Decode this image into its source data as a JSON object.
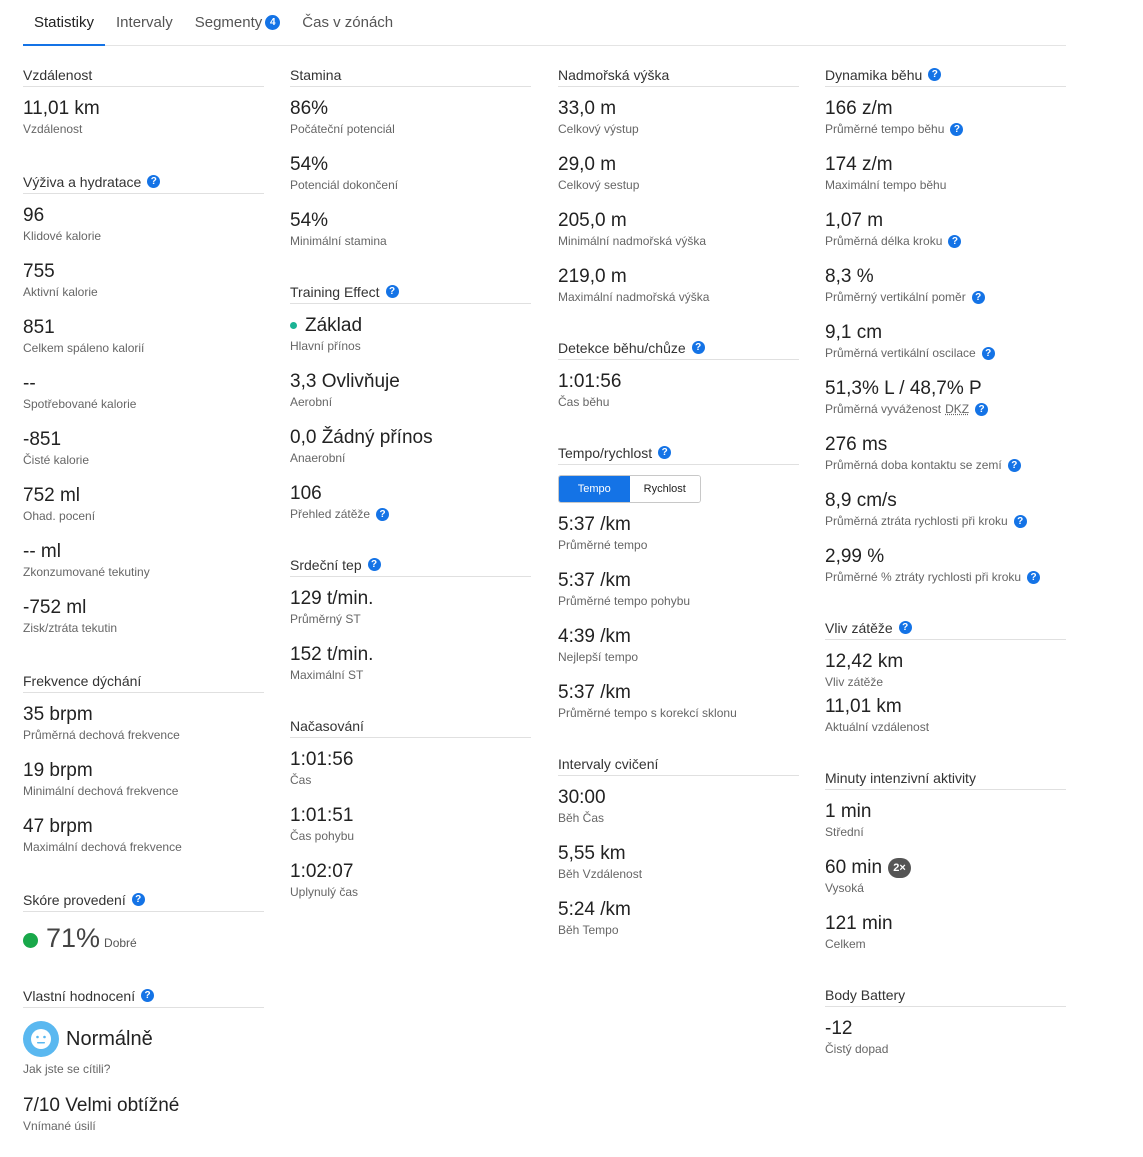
{
  "tabs": [
    {
      "label": "Statistiky"
    },
    {
      "label": "Intervaly"
    },
    {
      "label": "Segmenty",
      "badge": "4"
    },
    {
      "label": "Čas v zónách"
    }
  ],
  "distance": {
    "title": "Vzdálenost",
    "value": "11,01 km",
    "label": "Vzdálenost"
  },
  "nutrition": {
    "title": "Výživa a hydratace",
    "stats": [
      {
        "value": "96",
        "label": "Klidové kalorie"
      },
      {
        "value": "755",
        "label": "Aktivní kalorie"
      },
      {
        "value": "851",
        "label": "Celkem spáleno kalorií"
      },
      {
        "value": "--",
        "label": "Spotřebované kalorie"
      },
      {
        "value": "-851",
        "label": "Čisté kalorie"
      },
      {
        "value": "752 ml",
        "label": "Ohad. pocení"
      },
      {
        "value": "-- ml",
        "label": "Zkonzumované tekutiny"
      },
      {
        "value": "-752 ml",
        "label": "Zisk/ztráta tekutin"
      }
    ]
  },
  "breathing": {
    "title": "Frekvence dýchání",
    "stats": [
      {
        "value": "35 brpm",
        "label": "Průměrná dechová frekvence"
      },
      {
        "value": "19 brpm",
        "label": "Minimální dechová frekvence"
      },
      {
        "value": "47 brpm",
        "label": "Maximální dechová frekvence"
      }
    ]
  },
  "performance": {
    "title": "Skóre provedení",
    "value": "71%",
    "quality": "Dobré"
  },
  "self_eval": {
    "title": "Vlastní hodnocení",
    "feel": "Normálně",
    "feel_label": "Jak jste se cítili?",
    "effort": "7/10 Velmi obtížné",
    "effort_label": "Vnímané úsilí"
  },
  "stamina": {
    "title": "Stamina",
    "stats": [
      {
        "value": "86%",
        "label": "Počáteční potenciál"
      },
      {
        "value": "54%",
        "label": "Potenciál dokončení"
      },
      {
        "value": "54%",
        "label": "Minimální stamina"
      }
    ]
  },
  "training": {
    "title": "Training Effect",
    "primary": "Základ",
    "primary_label": "Hlavní přínos",
    "aerobic": "3,3 Ovlivňuje",
    "aerobic_label": "Aerobní",
    "anaerobic": "0,0 Žádný přínos",
    "anaerobic_label": "Anaerobní",
    "load": "106",
    "load_label": "Přehled zátěže"
  },
  "hr": {
    "title": "Srdeční tep",
    "stats": [
      {
        "value": "129 t/min.",
        "label": "Průměrný ST"
      },
      {
        "value": "152 t/min.",
        "label": "Maximální ST"
      }
    ]
  },
  "timing": {
    "title": "Načasování",
    "stats": [
      {
        "value": "1:01:56",
        "label": "Čas"
      },
      {
        "value": "1:01:51",
        "label": "Čas pohybu"
      },
      {
        "value": "1:02:07",
        "label": "Uplynulý čas"
      }
    ]
  },
  "elevation": {
    "title": "Nadmořská výška",
    "stats": [
      {
        "value": "33,0 m",
        "label": "Celkový výstup"
      },
      {
        "value": "29,0 m",
        "label": "Celkový sestup"
      },
      {
        "value": "205,0 m",
        "label": "Minimální nadmořská výška"
      },
      {
        "value": "219,0 m",
        "label": "Maximální nadmořská výška"
      }
    ]
  },
  "runwalk": {
    "title": "Detekce běhu/chůze",
    "value": "1:01:56",
    "label": "Čas běhu"
  },
  "pace": {
    "title": "Tempo/rychlost",
    "toggle_on": "Tempo",
    "toggle_off": "Rychlost",
    "stats": [
      {
        "value": "5:37 /km",
        "label": "Průměrné tempo"
      },
      {
        "value": "5:37 /km",
        "label": "Průměrné tempo pohybu"
      },
      {
        "value": "4:39 /km",
        "label": "Nejlepší tempo"
      },
      {
        "value": "5:37 /km",
        "label": "Průměrné tempo s korekcí sklonu"
      }
    ]
  },
  "intervals": {
    "title": "Intervaly cvičení",
    "stats": [
      {
        "value": "30:00",
        "label": "Běh Čas"
      },
      {
        "value": "5,55 km",
        "label": "Běh Vzdálenost"
      },
      {
        "value": "5:24 /km",
        "label": "Běh Tempo"
      }
    ]
  },
  "dynamics": {
    "title": "Dynamika běhu",
    "stats": [
      {
        "value": "166 z/m",
        "label": "Průměrné tempo běhu"
      },
      {
        "value": "174 z/m",
        "label": "Maximální tempo běhu"
      },
      {
        "value": "1,07 m",
        "label": "Průměrná délka kroku"
      },
      {
        "value": "8,3 %",
        "label": "Průměrný vertikální poměr"
      },
      {
        "value": "9,1 cm",
        "label": "Průměrná vertikální oscilace"
      },
      {
        "value": "51,3% L / 48,7% P",
        "label": "Průměrná vyváženost",
        "abbr": "DKZ"
      },
      {
        "value": "276 ms",
        "label": "Průměrná doba kontaktu se zemí"
      },
      {
        "value": "8,9 cm/s",
        "label": "Průměrná ztráta rychlosti při kroku"
      },
      {
        "value": "2,99 %",
        "label": "Průměrné % ztráty rychlosti při kroku"
      }
    ]
  },
  "grade": {
    "title": "Vliv zátěže",
    "stats": [
      {
        "value": "12,42 km",
        "label": "Vliv zátěže"
      },
      {
        "value": "11,01 km",
        "label": "Aktuální vzdálenost"
      }
    ]
  },
  "intensity": {
    "title": "Minuty intenzivní aktivity",
    "moderate": "1 min",
    "moderate_label": "Střední",
    "vigorous": "60 min",
    "vigorous_badge": "2×",
    "vigorous_label": "Vysoká",
    "total": "121 min",
    "total_label": "Celkem"
  },
  "battery": {
    "title": "Body Battery",
    "value": "-12",
    "label": "Čistý dopad"
  }
}
